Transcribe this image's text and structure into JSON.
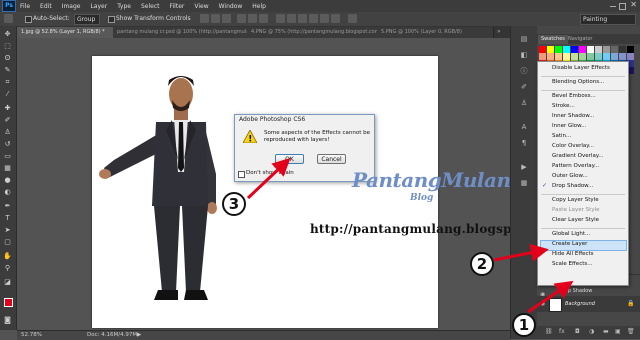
{
  "menubar": {
    "logo": "Ps",
    "items": [
      "File",
      "Edit",
      "Image",
      "Layer",
      "Type",
      "Select",
      "Filter",
      "View",
      "Window",
      "Help"
    ]
  },
  "options": {
    "auto_select_label": "Auto-Select:",
    "auto_select_value": "Group",
    "transform_label": "Show Transform Controls",
    "workspace": "Painting"
  },
  "tabs": [
    "1.jpg @ 52.8% (Layer 1, RGB/8) *",
    "pantang mulang cr.psd @ 100% (http://pantangmulang.blogspot.com)",
    "4.PNG @ 75% (http://pantangmulang.blogspot.com)",
    "5.PNG @ 100% (Layer 0, RGB/8)"
  ],
  "status": {
    "zoom": "52.78%",
    "doc": "Doc: 4.16M/4.97M"
  },
  "panels": {
    "tab_swatches": "Swatches",
    "tab_navigator": "Navigator"
  },
  "swatch_colors": [
    "#ff0000",
    "#ffff00",
    "#00ff00",
    "#00ffff",
    "#0000ff",
    "#ff00ff",
    "#ffffff",
    "#cccccc",
    "#999999",
    "#666666",
    "#333333",
    "#000000",
    "#f7977a",
    "#f9ad81",
    "#fdc68a",
    "#fff79a",
    "#c4df9b",
    "#a3d39c",
    "#82ca9d",
    "#7bcdc8",
    "#6ecff6",
    "#7ea7d8",
    "#8493ca",
    "#8882be",
    "#ed1c24",
    "#f26522",
    "#f7941d",
    "#fff200",
    "#8dc63f",
    "#39b54a",
    "#00a651",
    "#00a99d",
    "#00aeef",
    "#0072bc",
    "#0054a6",
    "#2e3192",
    "#9e0b0f",
    "#a0410d",
    "#a3620a",
    "#aba000",
    "#598527",
    "#197b30",
    "#007236",
    "#00746b",
    "#0076a3",
    "#004b80",
    "#003471",
    "#1b1464"
  ],
  "context_menu": {
    "items": [
      {
        "label": "Disable Layer Effects",
        "disabled": false
      },
      {
        "label": "Blending Options...",
        "disabled": false
      },
      {
        "label": "Bevel Emboss...",
        "disabled": false
      },
      {
        "label": "Stroke...",
        "disabled": false
      },
      {
        "label": "Inner Shadow...",
        "disabled": false
      },
      {
        "label": "Inner Glow...",
        "disabled": false
      },
      {
        "label": "Satin...",
        "disabled": false
      },
      {
        "label": "Color Overlay...",
        "disabled": false
      },
      {
        "label": "Gradient Overlay...",
        "disabled": false
      },
      {
        "label": "Pattern Overlay...",
        "disabled": false
      },
      {
        "label": "Outer Glow...",
        "disabled": false
      },
      {
        "label": "Drop Shadow...",
        "disabled": false,
        "checked": true
      },
      {
        "label": "Copy Layer Style",
        "disabled": false
      },
      {
        "label": "Paste Layer Style",
        "disabled": true
      },
      {
        "label": "Clear Layer Style",
        "disabled": false
      },
      {
        "label": "Global Light...",
        "disabled": false
      },
      {
        "label": "Create Layer",
        "disabled": false,
        "highlighted": true
      },
      {
        "label": "Hide All Effects",
        "disabled": false
      },
      {
        "label": "Scale Effects...",
        "disabled": false
      }
    ],
    "check_mark": "✓"
  },
  "layers": {
    "effect_label": "Drop Shadow",
    "layer_name": "Background"
  },
  "dialog": {
    "title": "Adobe Photoshop CS6",
    "message_line1": "Some aspects of the Effects cannot be",
    "message_line2": "reproduced with layers!",
    "ok": "OK",
    "cancel": "Cancel",
    "checkbox_label": "Don't show again"
  },
  "watermark": {
    "title": "PantangMulang",
    "blog": "Blog",
    "url": "http://pantangmulang.blogspot.com"
  },
  "callouts": [
    "1",
    "2",
    "3"
  ],
  "colors": {
    "accent_red": "#e3001b",
    "watermark_blue": "#6f8ec7",
    "menu_highlight": "#cde3f7"
  }
}
